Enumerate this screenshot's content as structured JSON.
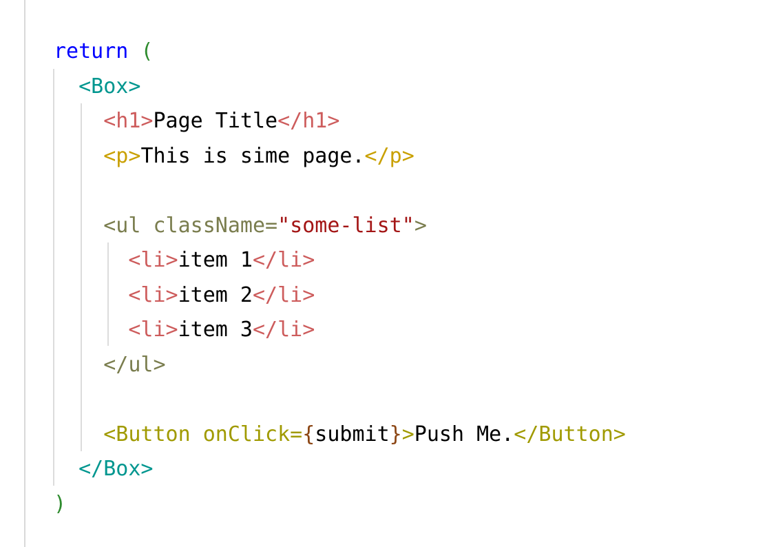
{
  "editor": {
    "lines": [
      {
        "indent": "",
        "tokens": [
          {
            "text": "return",
            "cls": "c-keyword"
          },
          {
            "text": " ",
            "cls": "c-text"
          },
          {
            "text": "(",
            "cls": "c-paren"
          }
        ]
      },
      {
        "indent": "  ",
        "tokens": [
          {
            "text": "<Box>",
            "cls": "c-teal"
          }
        ]
      },
      {
        "indent": "    ",
        "tokens": [
          {
            "text": "<h1>",
            "cls": "c-red"
          },
          {
            "text": "Page Title",
            "cls": "c-text"
          },
          {
            "text": "</h1>",
            "cls": "c-red"
          }
        ]
      },
      {
        "indent": "    ",
        "tokens": [
          {
            "text": "<p>",
            "cls": "c-gold"
          },
          {
            "text": "This is sime page.",
            "cls": "c-text"
          },
          {
            "text": "</p>",
            "cls": "c-gold"
          }
        ]
      },
      {
        "indent": "",
        "tokens": []
      },
      {
        "indent": "    ",
        "tokens": [
          {
            "text": "<ul className=",
            "cls": "c-olive"
          },
          {
            "text": "\"some-list\"",
            "cls": "c-string"
          },
          {
            "text": ">",
            "cls": "c-olive"
          }
        ]
      },
      {
        "indent": "      ",
        "tokens": [
          {
            "text": "<li>",
            "cls": "c-red"
          },
          {
            "text": "item 1",
            "cls": "c-text"
          },
          {
            "text": "</li>",
            "cls": "c-red"
          }
        ]
      },
      {
        "indent": "      ",
        "tokens": [
          {
            "text": "<li>",
            "cls": "c-red"
          },
          {
            "text": "item 2",
            "cls": "c-text"
          },
          {
            "text": "</li>",
            "cls": "c-red"
          }
        ]
      },
      {
        "indent": "      ",
        "tokens": [
          {
            "text": "<li>",
            "cls": "c-red"
          },
          {
            "text": "item 3",
            "cls": "c-text"
          },
          {
            "text": "</li>",
            "cls": "c-red"
          }
        ]
      },
      {
        "indent": "    ",
        "tokens": [
          {
            "text": "</ul>",
            "cls": "c-olive"
          }
        ]
      },
      {
        "indent": "",
        "tokens": []
      },
      {
        "indent": "    ",
        "tokens": [
          {
            "text": "<Button onClick=",
            "cls": "c-comp"
          },
          {
            "text": "{",
            "cls": "c-brace"
          },
          {
            "text": "submit",
            "cls": "c-text"
          },
          {
            "text": "}",
            "cls": "c-brace"
          },
          {
            "text": ">",
            "cls": "c-comp"
          },
          {
            "text": "Push Me.",
            "cls": "c-text"
          },
          {
            "text": "</Button>",
            "cls": "c-comp"
          }
        ]
      },
      {
        "indent": "  ",
        "tokens": [
          {
            "text": "</Box>",
            "cls": "c-teal"
          }
        ]
      },
      {
        "indent": "",
        "tokens": [
          {
            "text": ")",
            "cls": "c-paren"
          }
        ]
      }
    ]
  },
  "colors": {
    "keyword": "#0000ff",
    "paren": "#2e8b2e",
    "box_tag": "#00968f",
    "h1_li_tag": "#cd5c5c",
    "p_tag": "#c9a000",
    "ul_tag": "#7a7d4e",
    "string": "#a31515",
    "button_tag": "#a09a00",
    "brace": "#8b4513",
    "text": "#000000",
    "indent_guide": "#dcdcdc",
    "background": "#ffffff"
  }
}
